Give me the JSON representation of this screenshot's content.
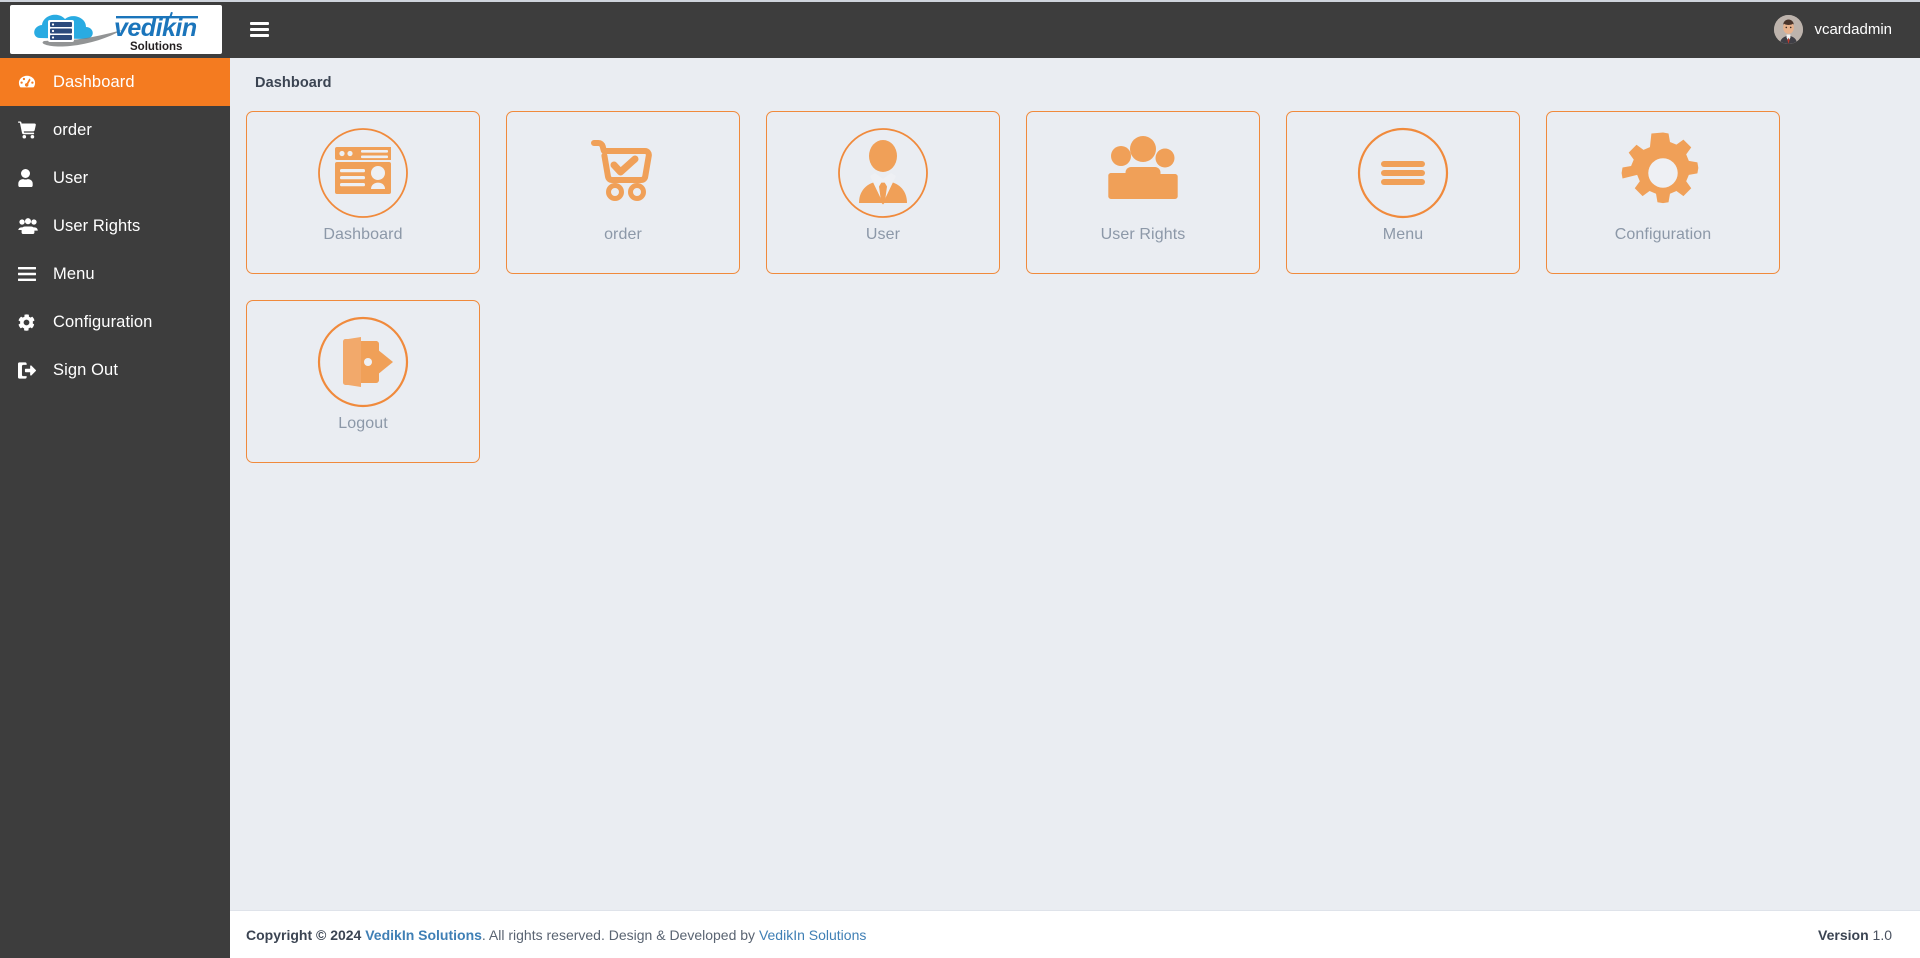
{
  "brand": {
    "name": "vedikin",
    "subtitle": "Solutions",
    "logo_icon": "cloud-server-logo"
  },
  "sidebar": {
    "items": [
      {
        "label": "Dashboard",
        "icon": "dashboard-gauge-icon",
        "active": true
      },
      {
        "label": "order",
        "icon": "shopping-cart-icon",
        "active": false
      },
      {
        "label": "User",
        "icon": "user-icon",
        "active": false
      },
      {
        "label": "User Rights",
        "icon": "users-group-icon",
        "active": false
      },
      {
        "label": "Menu",
        "icon": "hamburger-bars-icon",
        "active": false
      },
      {
        "label": "Configuration",
        "icon": "gear-icon",
        "active": false
      },
      {
        "label": "Sign Out",
        "icon": "sign-out-icon",
        "active": false
      }
    ]
  },
  "topbar": {
    "menu_toggle_icon": "hamburger-menu-icon",
    "avatar_icon": "user-avatar",
    "username": "vcardadmin"
  },
  "main": {
    "page_title": "Dashboard",
    "cards": [
      {
        "label": "Dashboard",
        "icon": "id-card-circle-icon"
      },
      {
        "label": "order",
        "icon": "cart-check-icon"
      },
      {
        "label": "User",
        "icon": "businessman-circle-icon"
      },
      {
        "label": "User Rights",
        "icon": "users-group-icon"
      },
      {
        "label": "Menu",
        "icon": "hamburger-circle-icon"
      },
      {
        "label": "Configuration",
        "icon": "gear-icon"
      },
      {
        "label": "Logout",
        "icon": "logout-door-circle-icon"
      }
    ]
  },
  "footer": {
    "copyright_prefix": "Copyright © 2024 ",
    "company_link": "VedikIn Solutions",
    "middle_text": ". All rights reserved. Design & Developed by ",
    "developer_link": "VedikIn Solutions",
    "version_label": "Version",
    "version_number": "1.0"
  },
  "colors": {
    "accent_orange": "#f47b20",
    "card_border": "#f08a3c",
    "sidebar_bg": "#3d3d3d",
    "content_bg": "#eaedf2",
    "link_blue": "#3f7fb5",
    "card_label": "#8c98a8"
  }
}
